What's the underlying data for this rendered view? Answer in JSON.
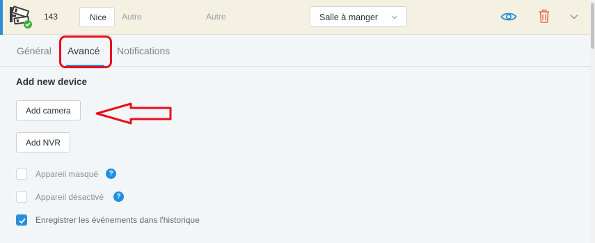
{
  "device": {
    "id": "143",
    "name_value": "Nice",
    "type_label": "Autre",
    "subtype_label": "Autre",
    "room": "Salle à manger",
    "icons": [
      "cctv-camera-icon",
      "online-check-icon",
      "eye-icon",
      "trash-icon",
      "chevron-down-icon"
    ]
  },
  "tabs": [
    {
      "label": "Général"
    },
    {
      "label": "Avancé"
    },
    {
      "label": "Notifications"
    }
  ],
  "active_tab": "Avancé",
  "section": {
    "title": "Add new device",
    "add_camera_label": "Add camera",
    "add_nvr_label": "Add NVR"
  },
  "options": [
    {
      "label": "Appareil masqué",
      "checked": false,
      "help": "?"
    },
    {
      "label": "Appareil désactivé",
      "checked": false,
      "help": "?"
    },
    {
      "label": "Enregistrer les événements dans l'historique",
      "checked": true
    }
  ],
  "colors": {
    "accent": "#2b8fd6",
    "annotation": "#e8101a",
    "delete": "#e0705a",
    "row_background": "#f4f0e2"
  }
}
